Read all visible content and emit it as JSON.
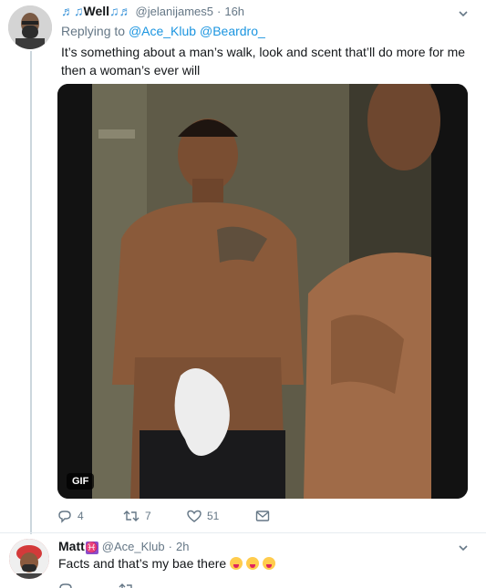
{
  "tweet1": {
    "display_name": "Well",
    "music_left": "♬♫",
    "music_right": "♫♬",
    "handle": "@jelanijames5",
    "separator": "·",
    "time": "16h",
    "replying_prefix": "Replying to",
    "replying_to": [
      "@Ace_Klub",
      "@Beardro_"
    ],
    "text": "It’s something about a man’s walk, look and scent that’ll do more for me then a woman’s ever will",
    "media_badge": "GIF",
    "reply_count": "4",
    "retweet_count": "7",
    "like_count": "51"
  },
  "tweet2": {
    "display_name": "Matt",
    "badge": "♓",
    "handle": "@Ace_Klub",
    "separator": "·",
    "time": "2h",
    "text": "Facts and that’s my bae there"
  },
  "icons": {
    "caret": "chevron-down-icon",
    "reply": "reply-icon",
    "retweet": "retweet-icon",
    "like": "heart-icon",
    "dm": "envelope-icon"
  },
  "colors": {
    "link": "#1b95e0",
    "muted": "#657786",
    "thread_line": "#ccd6dd"
  }
}
